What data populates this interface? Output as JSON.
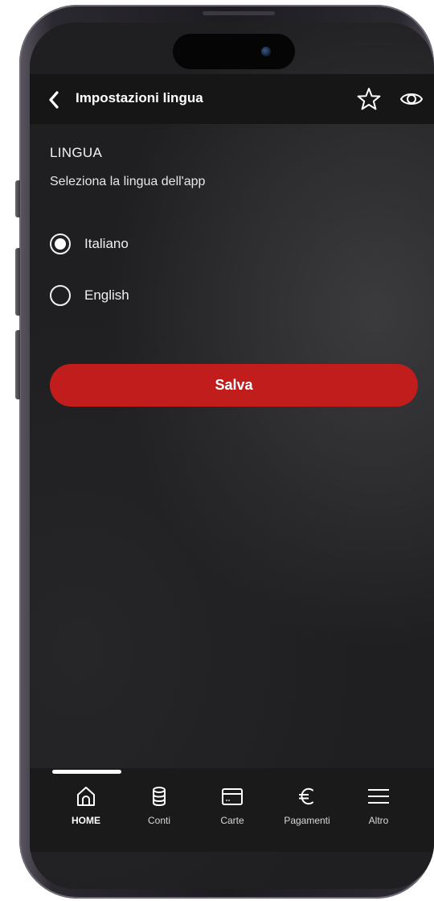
{
  "header": {
    "title": "Impostazioni lingua",
    "back_icon": "chevron-left-icon",
    "favorite_icon": "star-icon",
    "visibility_icon": "eye-icon"
  },
  "section": {
    "title": "LINGUA",
    "subtitle": "Seleziona la lingua dell'app"
  },
  "languages": [
    {
      "label": "Italiano",
      "selected": true
    },
    {
      "label": "English",
      "selected": false
    }
  ],
  "save_button": {
    "label": "Salva",
    "color": "#c11d1d"
  },
  "tab_bar": {
    "items": [
      {
        "label": "HOME",
        "icon": "home-icon",
        "active": true
      },
      {
        "label": "Conti",
        "icon": "database-icon",
        "active": false
      },
      {
        "label": "Carte",
        "icon": "card-icon",
        "active": false
      },
      {
        "label": "Pagamenti",
        "icon": "euro-icon",
        "active": false
      },
      {
        "label": "Altro",
        "icon": "menu-icon",
        "active": false
      }
    ]
  },
  "colors": {
    "background": "#1d1d1f",
    "header": "#161616",
    "accent": "#c11d1d",
    "text": "#ffffff"
  }
}
